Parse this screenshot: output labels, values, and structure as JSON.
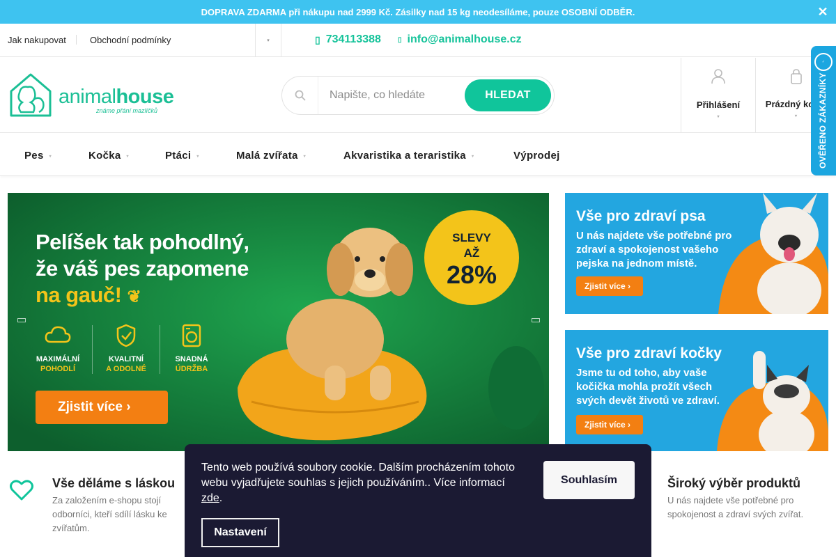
{
  "notice": {
    "text": "DOPRAVA ZDARMA při nákupu nad 2999 Kč. Zásilky nad 15 kg neodesíláme, pouze OSOBNÍ ODBĚR.",
    "close_icon": "✕"
  },
  "subnav": {
    "links": [
      "Jak nakupovat",
      "Obchodní podmínky"
    ],
    "more_icon": "▾",
    "phone": "734113388",
    "email": "info@animalhouse.cz"
  },
  "header": {
    "logo_text_light": "animal",
    "logo_text_bold": "house",
    "logo_tagline": "známe přání mazlíčků",
    "search_placeholder": "Napište, co hledáte",
    "search_button": "HLEDAT",
    "login_label": "Přihlášení",
    "cart_label": "Prázdný košík",
    "verified_label": "OVĚŘENO ZÁKAZNÍKY"
  },
  "menu": {
    "items": [
      "Pes",
      "Kočka",
      "Ptáci",
      "Malá zvířata",
      "Akvaristika a teraristika",
      "Výprodej"
    ]
  },
  "hero": {
    "title_line1": "Pelíšek tak pohodlný,",
    "title_line2": "že váš pes zapomene",
    "title_line3": "na gauč!",
    "features": [
      {
        "top": "MAXIMÁLNÍ",
        "bottom": "POHODLÍ"
      },
      {
        "top": "KVALITNÍ",
        "bottom": "A ODOLNÉ"
      },
      {
        "top": "SNADNÁ",
        "bottom": "ÚDRŽBA"
      }
    ],
    "cta": "Zjistit více",
    "badge_line1": "SLEVY",
    "badge_line2": "AŽ",
    "badge_value": "28%"
  },
  "side_banners": [
    {
      "title": "Vše pro zdraví psa",
      "text": "U nás najdete vše potřebné pro zdraví a spokojenost vašeho pejska na jednom místě.",
      "cta": "Zjistit více"
    },
    {
      "title": "Vše pro zdraví kočky",
      "text": "Jsme tu od toho, aby vaše kočička mohla prožít všech svých devět životů ve zdraví.",
      "cta": "Zjistit více"
    }
  ],
  "usps": [
    {
      "title": "Vše děláme s láskou",
      "text": "Za založením e-shopu stojí odborníci, kteří sdílí lásku ke zvířatům."
    },
    {
      "title": "Široký výběr produktů",
      "text": "U nás najdete vše potřebné pro spokojenost a zdraví svých zvířat."
    }
  ],
  "cookie": {
    "text": "Tento web používá soubory cookie. Dalším procházením tohoto webu vyjadřujete souhlas s jejich používáním.. Více informací",
    "link": "zde",
    "period": ".",
    "accept": "Souhlasím",
    "settings": "Nastavení"
  },
  "colors": {
    "accent": "#10c59b",
    "notice": "#3ec3f0",
    "cookie_bg": "#1b1a33",
    "banner_blue": "#23a6e0",
    "banner_orange": "#f37f12"
  }
}
